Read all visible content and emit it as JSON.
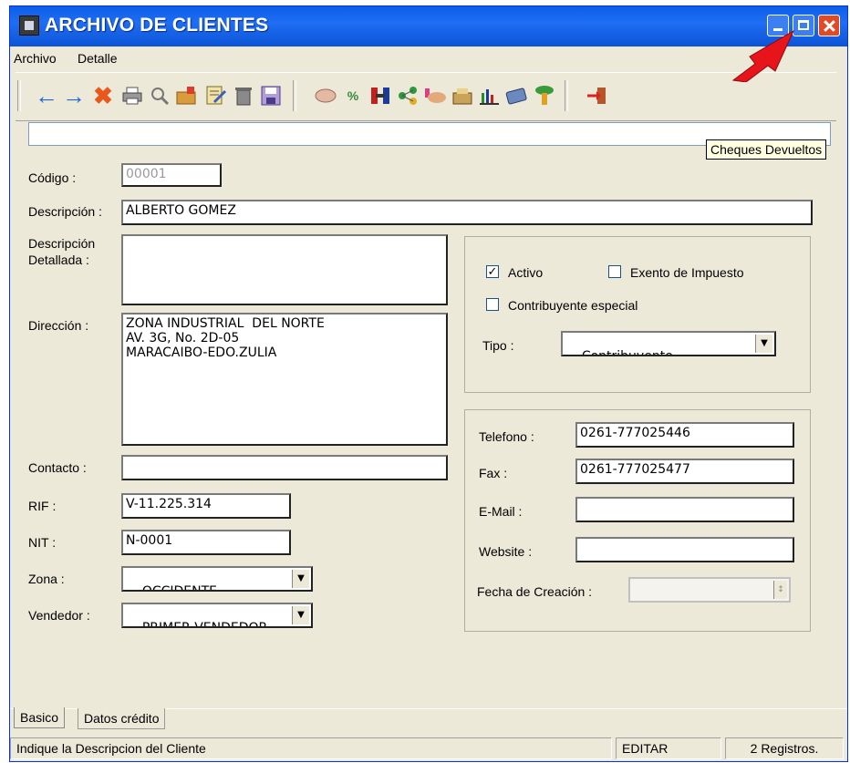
{
  "window": {
    "title": "ARCHIVO DE CLIENTES"
  },
  "menu": {
    "items": [
      "Archivo",
      "Detalle"
    ]
  },
  "toolbar": {
    "tooltip": "Cheques Devueltos",
    "buttons": [
      "back-arrow-icon",
      "forward-arrow-icon",
      "delete-x-icon",
      "print-icon",
      "search-icon",
      "folder-add-icon",
      "edit-document-icon",
      "trash-icon",
      "save-icon",
      "handshake-icon",
      "percent-icon",
      "transfer-icon",
      "network-icon",
      "payment-hand-icon",
      "cash-box-icon",
      "bar-chart-icon",
      "card-icon",
      "returned-cheques-icon",
      "exit-door-icon"
    ]
  },
  "form": {
    "codigo": {
      "label": "Código :",
      "value": "00001"
    },
    "descripcion": {
      "label": "Descripción :",
      "value": "ALBERTO GOMEZ"
    },
    "descripcion_detallada": {
      "label_line1": "Descripción",
      "label_line2": "Detallada :",
      "value": ""
    },
    "direccion": {
      "label": "Dirección :",
      "value": "ZONA INDUSTRIAL  DEL NORTE\nAV. 3G, No. 2D-05\nMARACAIBO-EDO.ZULIA"
    },
    "contacto": {
      "label": "Contacto :",
      "value": ""
    },
    "rif": {
      "label": "RIF :",
      "value": "V-11.225.314"
    },
    "nit": {
      "label": "NIT :",
      "value": "N-0001"
    },
    "zona": {
      "label": "Zona :",
      "value": "OCCIDENTE"
    },
    "vendedor": {
      "label": "Vendedor :",
      "value": "PRIMER VENDEDOR"
    },
    "activo": {
      "label": "Activo",
      "checked": true,
      "mark": "✓"
    },
    "exento": {
      "label": "Exento de Impuesto",
      "checked": false
    },
    "contribuyente_especial": {
      "label": "Contribuyente especial",
      "checked": false
    },
    "tipo": {
      "label": "Tipo :",
      "value": "Contribuyente"
    },
    "telefono": {
      "label": "Telefono :",
      "value": "0261-777025446"
    },
    "fax": {
      "label": "Fax :",
      "value": "0261-777025477"
    },
    "email": {
      "label": "E-Mail :",
      "value": ""
    },
    "website": {
      "label": "Website :",
      "value": ""
    },
    "fecha_creacion": {
      "label": "Fecha de Creación :",
      "value": ""
    }
  },
  "tabs": [
    "Basico",
    "Datos crédito"
  ],
  "status": {
    "message": "Indique  la Descripcion  del  Cliente",
    "mode": "EDITAR",
    "records": "2 Registros."
  },
  "colors": {
    "title_bar": "#0c53d6",
    "annotation_arrow": "#e8141c",
    "window_bg": "#ece9d8"
  }
}
